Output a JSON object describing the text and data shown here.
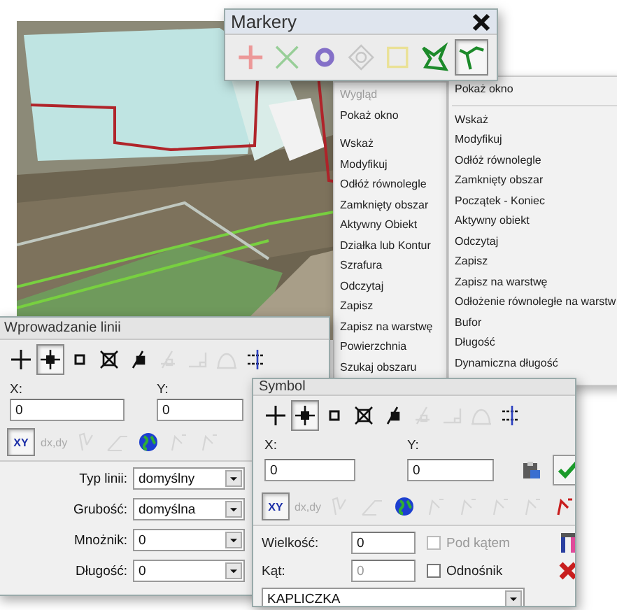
{
  "markery": {
    "title": "Markery",
    "tools": [
      {
        "kind": "plus",
        "disabled": true,
        "selected": false
      },
      {
        "kind": "x",
        "disabled": true,
        "selected": false
      },
      {
        "kind": "circle",
        "disabled": false,
        "selected": false
      },
      {
        "kind": "target",
        "disabled": true,
        "selected": false
      },
      {
        "kind": "square",
        "disabled": true,
        "selected": false
      },
      {
        "kind": "polygon",
        "disabled": false,
        "selected": false
      },
      {
        "kind": "polyline",
        "disabled": false,
        "selected": true
      }
    ]
  },
  "menu_left": {
    "items": [
      {
        "kind": "item",
        "label": "Wygląd",
        "disabled": true
      },
      {
        "kind": "item",
        "label": "Pokaż okno",
        "disabled": false
      },
      {
        "kind": "separator"
      },
      {
        "kind": "item",
        "label": "Wskaż",
        "disabled": false
      },
      {
        "kind": "item",
        "label": "Modyfikuj",
        "disabled": false
      },
      {
        "kind": "item",
        "label": "Odłóż równolegle",
        "disabled": false
      },
      {
        "kind": "item",
        "label": "Zamknięty obszar",
        "disabled": false
      },
      {
        "kind": "item",
        "label": "Aktywny Obiekt",
        "disabled": false
      },
      {
        "kind": "item",
        "label": "Działka lub Kontur",
        "disabled": false
      },
      {
        "kind": "item",
        "label": "Szrafura",
        "disabled": false
      },
      {
        "kind": "item",
        "label": "Odczytaj",
        "disabled": false
      },
      {
        "kind": "item",
        "label": "Zapisz",
        "disabled": false
      },
      {
        "kind": "item",
        "label": "Zapisz na warstwę",
        "disabled": false
      },
      {
        "kind": "item",
        "label": "Powierzchnia",
        "disabled": false
      },
      {
        "kind": "item",
        "label": "Szukaj obszaru",
        "disabled": false
      }
    ]
  },
  "menu_right": {
    "items": [
      {
        "kind": "item",
        "label": "Pokaż okno",
        "disabled": false
      },
      {
        "kind": "separator"
      },
      {
        "kind": "item",
        "label": "Wskaż",
        "disabled": false
      },
      {
        "kind": "item",
        "label": "Modyfikuj",
        "disabled": false
      },
      {
        "kind": "item",
        "label": "Odłóż równolegle",
        "disabled": false
      },
      {
        "kind": "item",
        "label": "Zamknięty obszar",
        "disabled": false
      },
      {
        "kind": "item",
        "label": "Początek - Koniec",
        "disabled": false
      },
      {
        "kind": "item",
        "label": "Aktywny obiekt",
        "disabled": false
      },
      {
        "kind": "item",
        "label": "Odczytaj",
        "disabled": false
      },
      {
        "kind": "item",
        "label": "Zapisz",
        "disabled": false
      },
      {
        "kind": "item",
        "label": "Zapisz na warstwę",
        "disabled": false
      },
      {
        "kind": "item",
        "label": "Odłożenie równoległe na warstw",
        "disabled": false
      },
      {
        "kind": "item",
        "label": "Bufor",
        "disabled": false
      },
      {
        "kind": "item",
        "label": "Długość",
        "disabled": false
      },
      {
        "kind": "item",
        "label": "Dynamiczna długość",
        "disabled": false
      }
    ]
  },
  "line_window": {
    "title": "Wprowadzanie linii",
    "snap_tools": [
      {
        "kind": "plus",
        "selected": false,
        "disabled": false
      },
      {
        "kind": "crosshair",
        "selected": true,
        "disabled": false
      },
      {
        "kind": "square",
        "selected": false,
        "disabled": false
      },
      {
        "kind": "x-square",
        "selected": false,
        "disabled": false
      },
      {
        "kind": "pin",
        "selected": false,
        "disabled": false
      },
      {
        "kind": "perp",
        "selected": false,
        "disabled": true
      },
      {
        "kind": "angle",
        "selected": false,
        "disabled": true
      },
      {
        "kind": "arc",
        "selected": false,
        "disabled": true
      },
      {
        "kind": "snap-grid",
        "selected": false,
        "disabled": false
      }
    ],
    "x_label": "X:",
    "x_value": "0",
    "y_label": "Y:",
    "y_value": "0",
    "coord_tools": [
      {
        "kind": "text",
        "label": "XY",
        "selected": true,
        "disabled": false
      },
      {
        "kind": "text",
        "label": "dx,dy",
        "selected": false,
        "disabled": true
      },
      {
        "kind": "pencil",
        "selected": false,
        "disabled": true
      },
      {
        "kind": "slope",
        "selected": false,
        "disabled": true
      },
      {
        "kind": "globe",
        "selected": false,
        "disabled": false
      },
      {
        "kind": "bend",
        "selected": false,
        "disabled": true
      },
      {
        "kind": "bend",
        "selected": false,
        "disabled": true
      }
    ],
    "fields": [
      {
        "label": "Typ linii:",
        "value": "domyślny"
      },
      {
        "label": "Grubość:",
        "value": "domyślna"
      },
      {
        "label": "Mnożnik:",
        "value": "0"
      },
      {
        "label": "Długość:",
        "value": "0"
      }
    ]
  },
  "symbol_window": {
    "title": "Symbol",
    "snap_tools": [
      {
        "kind": "plus",
        "selected": false,
        "disabled": false
      },
      {
        "kind": "crosshair",
        "selected": true,
        "disabled": false
      },
      {
        "kind": "square",
        "selected": false,
        "disabled": false
      },
      {
        "kind": "x-square",
        "selected": false,
        "disabled": false
      },
      {
        "kind": "pin",
        "selected": false,
        "disabled": false
      },
      {
        "kind": "perp",
        "selected": false,
        "disabled": true
      },
      {
        "kind": "angle",
        "selected": false,
        "disabled": true
      },
      {
        "kind": "arc",
        "selected": false,
        "disabled": true
      },
      {
        "kind": "snap-grid",
        "selected": false,
        "disabled": false
      }
    ],
    "x_label": "X:",
    "x_value": "0",
    "y_label": "Y:",
    "y_value": "0",
    "coord_tools": [
      {
        "kind": "text",
        "label": "XY",
        "selected": true,
        "disabled": false
      },
      {
        "kind": "text",
        "label": "dx,dy",
        "selected": false,
        "disabled": true
      },
      {
        "kind": "pencil",
        "selected": false,
        "disabled": true
      },
      {
        "kind": "slope",
        "selected": false,
        "disabled": true
      },
      {
        "kind": "globe",
        "selected": false,
        "disabled": false
      },
      {
        "kind": "bend",
        "selected": false,
        "disabled": true
      },
      {
        "kind": "bend",
        "selected": false,
        "disabled": true
      },
      {
        "kind": "bend",
        "selected": false,
        "disabled": true
      },
      {
        "kind": "bend",
        "selected": false,
        "disabled": true
      },
      {
        "kind": "bend-red",
        "selected": false,
        "disabled": false
      }
    ],
    "size_label": "Wielkość:",
    "size_value": "0",
    "angle_label": "Kąt:",
    "angle_value": "0",
    "angle_disabled": true,
    "checkboxes": [
      {
        "label": "Pod kątem",
        "checked": false,
        "disabled": true
      },
      {
        "label": "Odnośnik",
        "checked": false,
        "disabled": false
      }
    ],
    "symbol_value": "KAPLICZKA"
  }
}
